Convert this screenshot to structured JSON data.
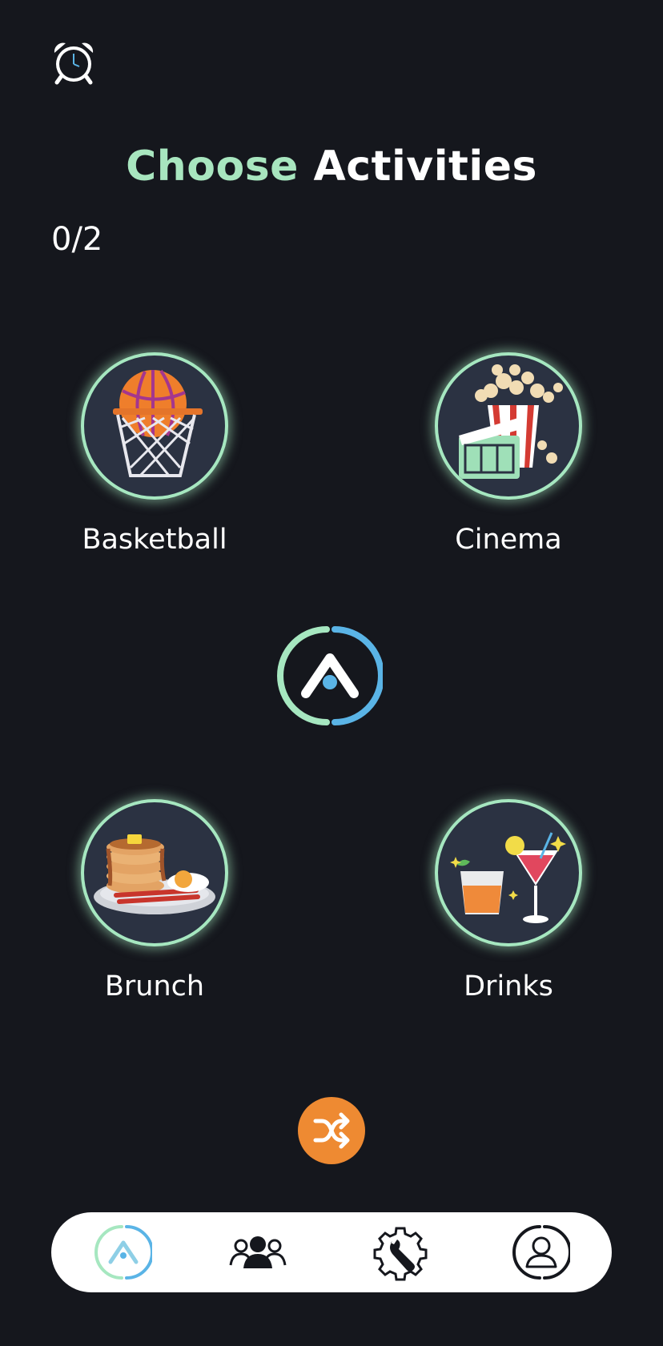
{
  "header": {
    "title_accent": "Choose",
    "title_rest": "Activities",
    "counter": "0/2"
  },
  "icons": {
    "alarm": "alarm-clock-icon",
    "logo": "app-logo-icon",
    "shuffle": "shuffle-icon"
  },
  "activities": [
    {
      "label": "Basketball",
      "icon": "basketball-hoop-icon"
    },
    {
      "label": "Cinema",
      "icon": "popcorn-clapperboard-icon"
    },
    {
      "label": "Brunch",
      "icon": "pancakes-breakfast-icon"
    },
    {
      "label": "Drinks",
      "icon": "cocktail-drinks-icon"
    }
  ],
  "nav": {
    "items": [
      {
        "id": "home",
        "icon": "app-logo-icon",
        "active": true
      },
      {
        "id": "friends",
        "icon": "group-icon",
        "active": false
      },
      {
        "id": "settings",
        "icon": "wrench-gear-icon",
        "active": false
      },
      {
        "id": "profile",
        "icon": "profile-icon",
        "active": false
      }
    ]
  },
  "colors": {
    "background": "#15171d",
    "accent_green": "#a8e6bf",
    "accent_blue": "#5ab4e6",
    "shuffle_orange": "#ee8a32",
    "circle_fill": "#2b3242"
  }
}
